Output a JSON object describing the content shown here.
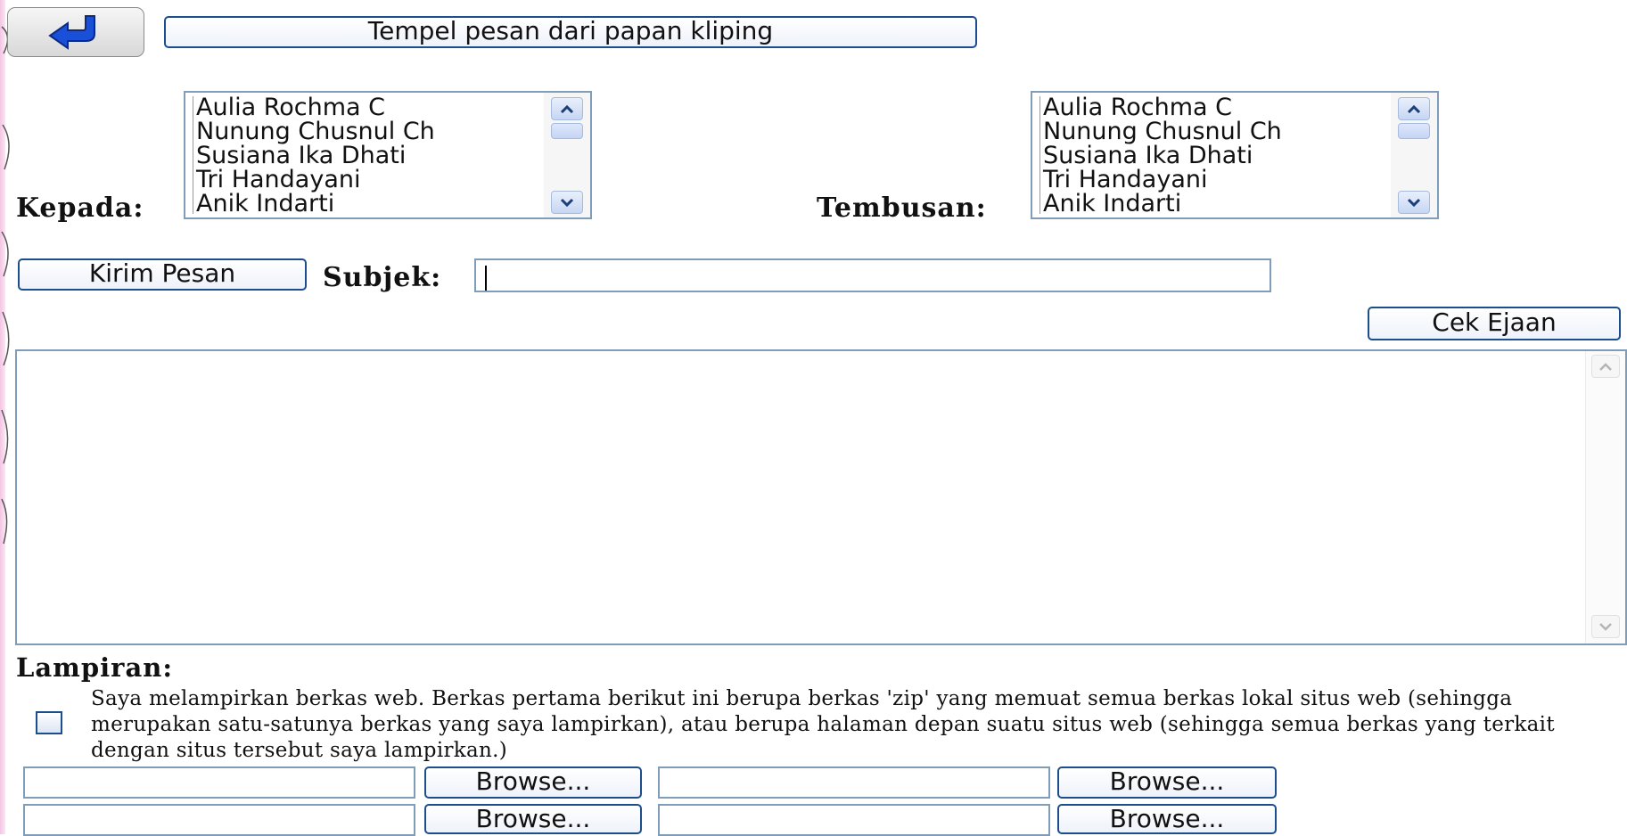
{
  "toolbar": {
    "back_icon": "back-arrow-icon",
    "paste_label": "Tempel pesan dari papan kliping"
  },
  "recipients": {
    "to_label": "Kepada:",
    "cc_label": "Tembusan:",
    "options": [
      "Aulia Rochma C",
      "Nunung Chusnul Ch",
      "Susiana Ika Dhati",
      "Tri Handayani",
      "Anik Indarti"
    ]
  },
  "compose": {
    "send_label": "Kirim Pesan",
    "subject_label": "Subjek:",
    "subject_value": "",
    "spellcheck_label": "Cek Ejaan",
    "body_value": ""
  },
  "attachments": {
    "heading": "Lampiran:",
    "web_files_text": "Saya melampirkan berkas web. Berkas pertama berikut ini berupa berkas 'zip' yang memuat semua berkas lokal situs web (sehingga merupakan satu-satunya berkas yang saya lampirkan), atau berupa halaman depan suatu situs web (sehingga semua berkas yang terkait dengan situs tersebut saya lampirkan.)",
    "web_files_checked": false,
    "browse_label": "Browse..."
  },
  "colors": {
    "border_blue": "#1c4e8c",
    "field_border": "#7f9db9",
    "back_arrow": "#1a4fd8"
  }
}
